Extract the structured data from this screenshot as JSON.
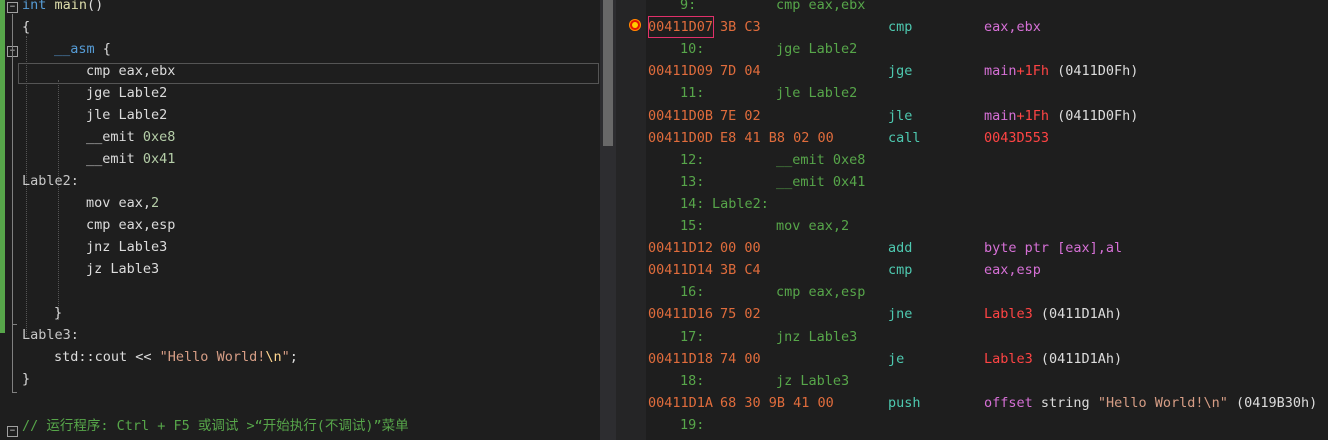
{
  "source": {
    "lines": [
      {
        "text": "int main()"
      },
      {
        "text": "{"
      },
      {
        "text": "__asm {"
      },
      {
        "text": "cmp eax,ebx"
      },
      {
        "text": "jge Lable2"
      },
      {
        "text": "jle Lable2"
      },
      {
        "text": "__emit 0xe8"
      },
      {
        "text": "__emit 0x41"
      },
      {
        "text": "Lable2:"
      },
      {
        "text": "mov eax,2"
      },
      {
        "text": "cmp eax,esp"
      },
      {
        "text": "jnz Lable3"
      },
      {
        "text": "jz Lable3"
      },
      {
        "text": ""
      },
      {
        "text": "}"
      },
      {
        "text": "Lable3:"
      },
      {
        "text": "std::cout << \"Hello World!\\n\";"
      },
      {
        "text": "}"
      },
      {
        "text": ""
      },
      {
        "text": "// 运行程序: Ctrl + F5 或调试 >“开始执行(不调试)”菜单"
      }
    ],
    "tokens": {
      "int": "int",
      "main": "main",
      "parens": "()",
      "asm": "__asm",
      "brace_open": " {",
      "cmp": "cmp",
      "eax_ebx": "eax,ebx",
      "jge": "jge",
      "lable2": "Lable2",
      "jle": "jle",
      "emit": "__emit",
      "hex_e8": "0xe8",
      "hex_41": "0x41",
      "lable2_colon": "Lable2:",
      "mov": "mov",
      "eax_comma": "eax,",
      "two": "2",
      "eax_esp": "eax,esp",
      "jnz": "jnz",
      "lable3": "Lable3",
      "jz": "jz",
      "close_brace": "}",
      "open_brace": "{",
      "lable3_colon": "Lable3:",
      "std_cout": "std::cout",
      "shift": " << ",
      "str_open": "\"Hello World!",
      "esc": "\\n",
      "str_close": "\"",
      "semicolon": ";",
      "comment": "// 运行程序: Ctrl + F5 或调试 >“开始执行(不调试)”菜单"
    }
  },
  "disasm": {
    "rows": [
      {
        "kind": "src",
        "num": "9:",
        "code": "cmp eax,ebx"
      },
      {
        "kind": "ins",
        "addr": "00411D07",
        "bytes": "3B C3",
        "mn": "cmp",
        "op": "eax,ebx",
        "current": true
      },
      {
        "kind": "src",
        "num": "10:",
        "code": "jge Lable2"
      },
      {
        "kind": "ins",
        "addr": "00411D09",
        "bytes": "7D 04",
        "mn": "jge",
        "op_sym": "main",
        "op_rest": "+1Fh",
        "op_tail": " (0411D0Fh)"
      },
      {
        "kind": "src",
        "num": "11:",
        "code": "jle Lable2"
      },
      {
        "kind": "ins",
        "addr": "00411D0B",
        "bytes": "7E 02",
        "mn": "jle",
        "op_sym": "main",
        "op_rest": "+1Fh",
        "op_tail": " (0411D0Fh)"
      },
      {
        "kind": "ins",
        "addr": "00411D0D",
        "bytes": "E8 41 B8 02 00",
        "mn": "call",
        "op_call": "0043D553"
      },
      {
        "kind": "src",
        "num": "12:",
        "code": "__emit 0xe8"
      },
      {
        "kind": "src",
        "num": "13:",
        "code": "__emit 0x41"
      },
      {
        "kind": "src",
        "num": "14:",
        "code": "Lable2:",
        "label": true
      },
      {
        "kind": "src",
        "num": "15:",
        "code": "mov eax,2"
      },
      {
        "kind": "ins",
        "addr": "00411D12",
        "bytes": "00 00",
        "mn": "add",
        "op_kw": "byte ptr ",
        "op_plain": "[eax],al"
      },
      {
        "kind": "ins",
        "addr": "00411D14",
        "bytes": "3B C4",
        "mn": "cmp",
        "op": "eax,esp"
      },
      {
        "kind": "src",
        "num": "16:",
        "code": "cmp eax,esp"
      },
      {
        "kind": "ins",
        "addr": "00411D16",
        "bytes": "75 02",
        "mn": "jne",
        "op_sym": "Lable3",
        "op_tail": " (0411D1Ah)"
      },
      {
        "kind": "src",
        "num": "17:",
        "code": "jnz Lable3"
      },
      {
        "kind": "ins",
        "addr": "00411D18",
        "bytes": "74 00",
        "mn": "je",
        "op_sym": "Lable3",
        "op_tail": " (0411D1Ah)"
      },
      {
        "kind": "src",
        "num": "18:",
        "code": "jz Lable3"
      },
      {
        "kind": "ins",
        "addr": "00411D1A",
        "bytes": "68 30 9B 41 00",
        "mn": "push",
        "op_kw": "offset",
        "op_plain": " string ",
        "op_str": "\"Hello World!\\n\"",
        "op_tail": " (0419B30h)"
      },
      {
        "kind": "src",
        "num": "19:",
        "code": ""
      },
      {
        "kind": "src",
        "num": "",
        "code": ""
      }
    ]
  },
  "colors": {
    "background": "#1e1e1e",
    "address": "#e06c3c",
    "mnemonic": "#4ec9b0",
    "operand": "#d670d6",
    "symbol": "#ff4444",
    "source_line": "#57a64a",
    "keyword": "#569cd6",
    "breakpoint": "#e51400"
  },
  "icons": {
    "breakpoint": "breakpoint-icon",
    "fold": "fold-toggle-icon"
  }
}
